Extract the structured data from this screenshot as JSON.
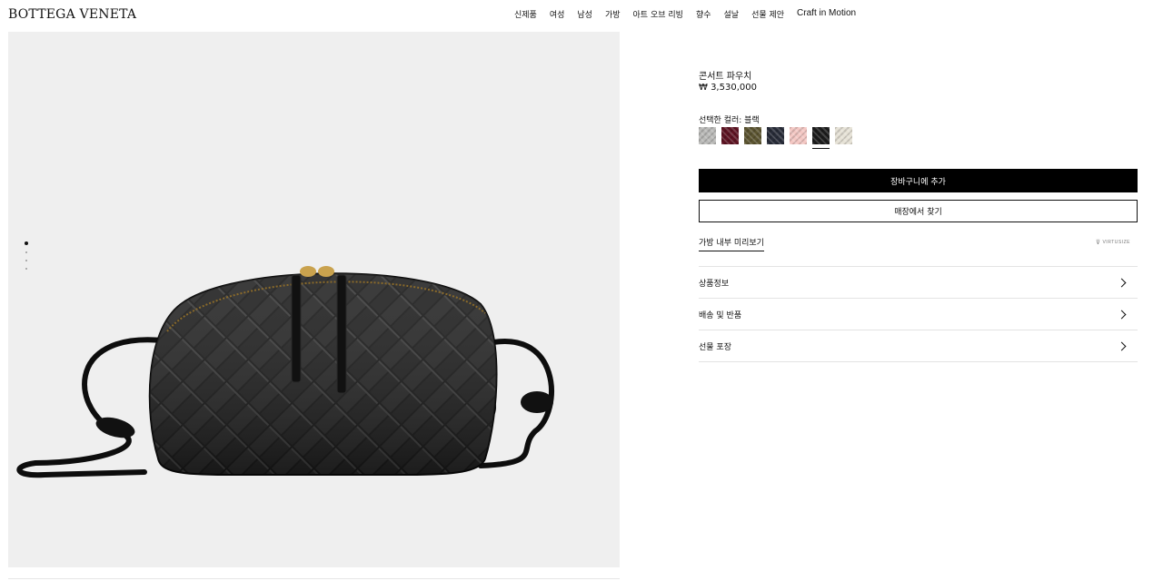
{
  "header": {
    "logo": "BOTTEGA VENETA",
    "nav": [
      "신제품",
      "여성",
      "남성",
      "가방",
      "아트 오브 리빙",
      "향수",
      "설날",
      "선물 제안",
      "Craft in Motion"
    ]
  },
  "gallery": {
    "slide_count": 4,
    "active_slide": 1
  },
  "product": {
    "name": "콘서트 파우치",
    "price": "₩ 3,530,000",
    "color_label": "선택한 컬러: 블랙",
    "swatches": [
      {
        "color": "#b9b9b7",
        "selected": false
      },
      {
        "color": "#5e1322",
        "selected": false
      },
      {
        "color": "#5b5430",
        "selected": false
      },
      {
        "color": "#272b38",
        "selected": false
      },
      {
        "color": "#f4c7c3",
        "selected": false
      },
      {
        "color": "#1b1b1b",
        "selected": true
      },
      {
        "color": "#e6e2d6",
        "selected": false
      }
    ],
    "add_to_cart": "장바구니에 추가",
    "find_in_store": "매장에서 찾기",
    "preview_inside": "가방 내부 미리보기",
    "virtusize": "VIRTUSIZE",
    "accordion": [
      "상품정보",
      "배송 및 반품",
      "선물 포장"
    ]
  },
  "colors": {
    "accent": "#000000",
    "gallery_bg": "#efefef",
    "divider": "#e3e3e3"
  }
}
